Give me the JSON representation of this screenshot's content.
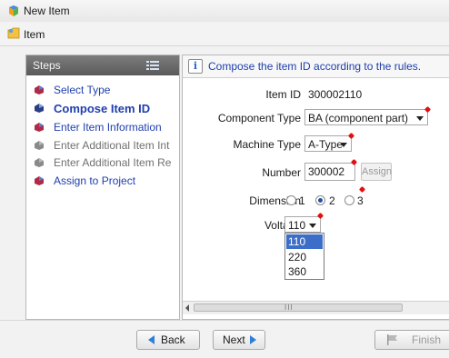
{
  "window": {
    "title": "New Item",
    "subtitle": "Item",
    "icon": "new-item-icon"
  },
  "steps": {
    "header": "Steps",
    "items": [
      {
        "label": "Select Type",
        "state": "done",
        "icon": "done-step-icon"
      },
      {
        "label": "Compose Item ID",
        "state": "current",
        "icon": "current-step-icon"
      },
      {
        "label": "Enter Item Information",
        "state": "done",
        "icon": "done-step-icon"
      },
      {
        "label": "Enter Additional Item Int",
        "state": "disabled",
        "icon": "disabled-step-icon"
      },
      {
        "label": "Enter Additional Item Re",
        "state": "disabled",
        "icon": "disabled-step-icon"
      },
      {
        "label": "Assign to Project",
        "state": "done",
        "icon": "done-step-icon"
      }
    ]
  },
  "main": {
    "instruction": "Compose the item ID according to the rules.",
    "fields": {
      "item_id": {
        "label": "Item ID",
        "value": "300002110"
      },
      "component_type": {
        "label": "Component Type",
        "value": "BA (component part)"
      },
      "machine_type": {
        "label": "Machine Type",
        "value": "A-Type"
      },
      "number": {
        "label": "Number",
        "value": "300002",
        "button": "Assign"
      },
      "dimension": {
        "label": "Dimension",
        "options": [
          "1",
          "2",
          "3"
        ],
        "selected": "2"
      },
      "voltage": {
        "label": "Voltage",
        "value": "110",
        "options": [
          "110",
          "220",
          "360"
        ],
        "highlighted": "110"
      }
    },
    "scroll_grip": "III"
  },
  "footer": {
    "back": "Back",
    "next": "Next",
    "finish": "Finish"
  },
  "colors": {
    "link_blue": "#1f3fae",
    "highlight": "#3c6ec9",
    "required": "#e01010",
    "arrow": "#2f7fd8"
  }
}
